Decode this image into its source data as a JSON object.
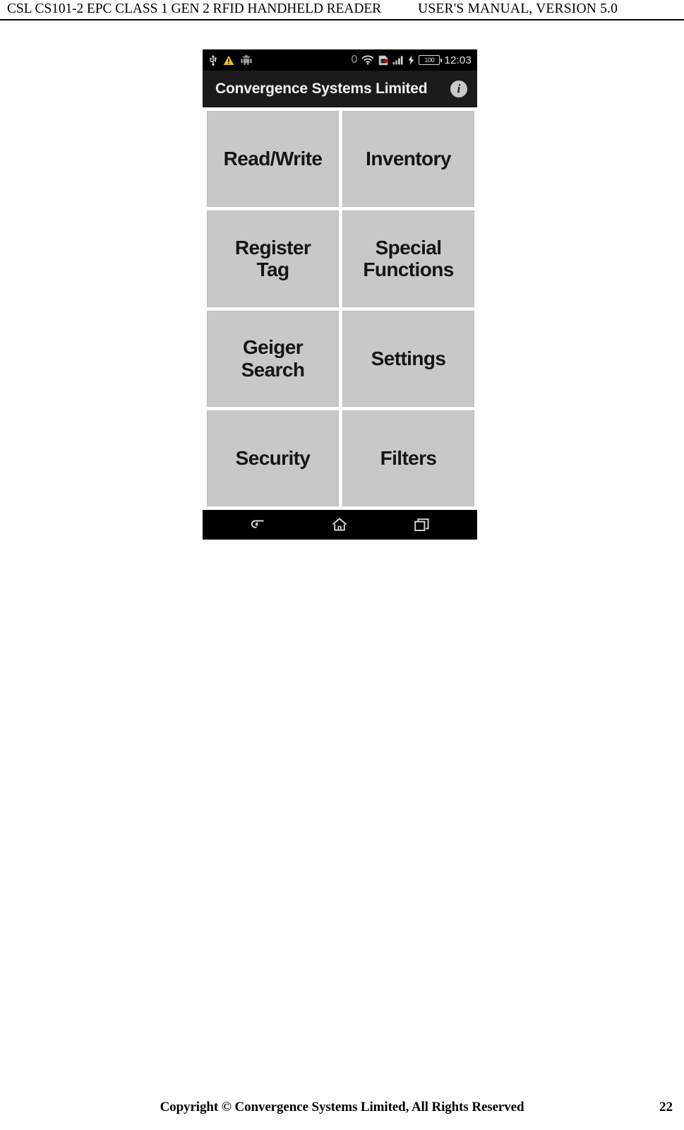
{
  "page": {
    "header_left": "CSL CS101-2 EPC CLASS 1 GEN 2 RFID HANDHELD READER",
    "header_right": "USER'S  MANUAL,  VERSION  5.0",
    "footer_copyright": "Copyright © Convergence Systems Limited, All Rights Reserved",
    "footer_page_number": "22"
  },
  "screenshot": {
    "status_bar": {
      "left_icons": [
        "usb-icon",
        "warning-triangle-icon",
        "android-robot-icon"
      ],
      "notification_count": "0",
      "right_icons": [
        "wifi-icon",
        "sim-card-icon",
        "signal-bars-icon",
        "charging-bolt-icon"
      ],
      "battery_level": "100",
      "time": "12:03",
      "background_color": "#000000"
    },
    "title_bar": {
      "title": "Convergence Systems Limited",
      "info_icon_label": "i",
      "background_color": "#1b1b1b"
    },
    "menu": {
      "button_color": "#c8c8c8",
      "buttons": [
        {
          "id": "read-write",
          "label": "Read/Write"
        },
        {
          "id": "inventory",
          "label": "Inventory"
        },
        {
          "id": "register-tag",
          "label": "Register\nTag"
        },
        {
          "id": "special-functions",
          "label": "Special\nFunctions"
        },
        {
          "id": "geiger-search",
          "label": "Geiger\nSearch"
        },
        {
          "id": "settings",
          "label": "Settings"
        },
        {
          "id": "security",
          "label": "Security"
        },
        {
          "id": "filters",
          "label": "Filters"
        }
      ]
    },
    "nav_bar": {
      "buttons": [
        "back-icon",
        "home-icon",
        "recent-apps-icon"
      ],
      "background_color": "#000000"
    }
  }
}
